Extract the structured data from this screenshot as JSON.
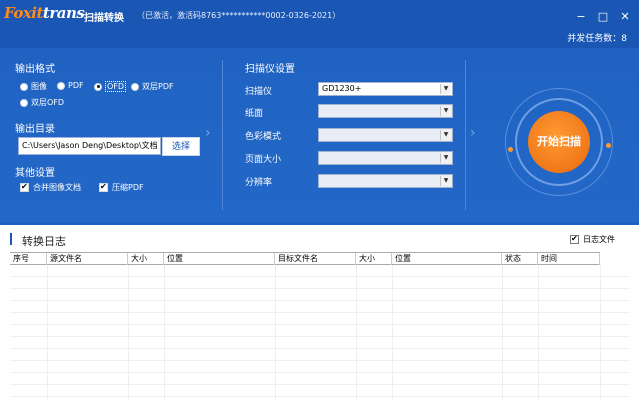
{
  "titlebar": {
    "logo_fox": "Foxit",
    "logo_trans": "trans",
    "app_title": "扫描转换",
    "app_subtitle": "（已激活，激活码8763***********0002-0326-2021）",
    "minimize_glyph": "−",
    "maximize_glyph": "□",
    "close_glyph": "✕",
    "concurrent_tasks": "并发任务数：8"
  },
  "output_format": {
    "title": "输出格式",
    "options": [
      {
        "label": "图像",
        "selected": false
      },
      {
        "label": "PDF",
        "selected": false
      },
      {
        "label": "OFD",
        "selected": true
      },
      {
        "label": "双层PDF",
        "selected": false
      },
      {
        "label": "双层OFD",
        "selected": false
      }
    ]
  },
  "output_dir": {
    "title": "输出目录",
    "path": "C:\\Users\\Jason Deng\\Desktop\\文档",
    "browse_label": "选择"
  },
  "other_settings": {
    "title": "其他设置",
    "merge_images": {
      "label": "合并图像文档",
      "checked": true
    },
    "compress_pdf": {
      "label": "压缩PDF",
      "checked": true
    }
  },
  "scanner_settings": {
    "title": "扫描仪设置",
    "fields": [
      {
        "label": "扫描仪",
        "value": "GD1230+"
      },
      {
        "label": "纸面",
        "value": ""
      },
      {
        "label": "色彩模式",
        "value": ""
      },
      {
        "label": "页面大小",
        "value": ""
      },
      {
        "label": "分辨率",
        "value": ""
      }
    ]
  },
  "start_button": {
    "label": "开始扫描"
  },
  "log": {
    "title": "转换日志",
    "log_file": {
      "label": "日志文件",
      "checked": true
    },
    "columns": [
      "序号",
      "源文件名",
      "大小",
      "位置",
      "目标文件名",
      "大小",
      "位置",
      "状态",
      "时间"
    ]
  },
  "colors": {
    "primary": "#1f5fbd",
    "accent": "#f07818"
  }
}
